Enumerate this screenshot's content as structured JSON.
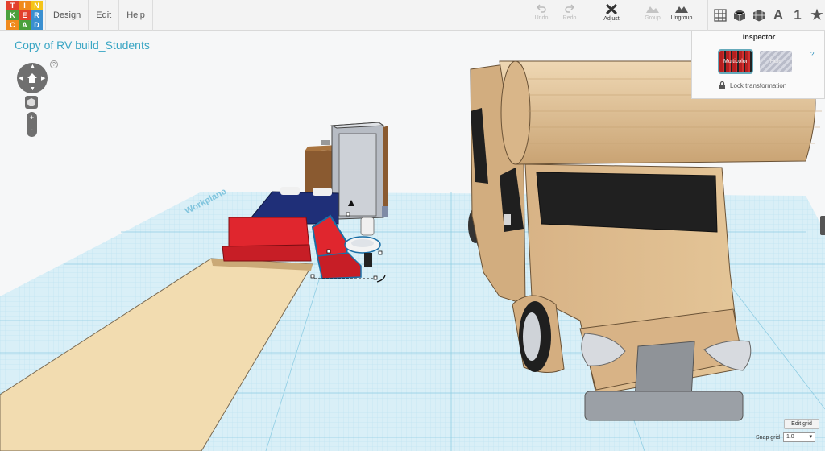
{
  "app": {
    "logo_letters": [
      "T",
      "I",
      "N",
      "K",
      "E",
      "R",
      "C",
      "A",
      "D"
    ],
    "logo_colors": [
      "#e2402c",
      "#f08a1c",
      "#f4c41a",
      "#4aa03c",
      "#e2402c",
      "#3a8fd0",
      "#f08a1c",
      "#4aa03c",
      "#3a8fd0"
    ]
  },
  "menu": {
    "items": [
      {
        "label": "Design"
      },
      {
        "label": "Edit"
      },
      {
        "label": "Help"
      }
    ]
  },
  "toolbar": {
    "undo_label": "Undo",
    "redo_label": "Redo",
    "adjust_label": "Adjust",
    "group_label": "Group",
    "ungroup_label": "Ungroup"
  },
  "view_icons": {
    "text_label": "A",
    "number_label": "1",
    "star_label": "★"
  },
  "project": {
    "title": "Copy of RV build_Students"
  },
  "help_mark": "?",
  "inspector": {
    "title": "Inspector",
    "solid_label": "Multicolor",
    "hole_label": "Hole",
    "help_mark": "?",
    "lock_label": "Lock transformation"
  },
  "grid": {
    "edit_label": "Edit grid",
    "snap_label": "Snap grid",
    "snap_value": "1.0"
  },
  "workplane": {
    "label": "Workplane"
  },
  "colors": {
    "accent": "#3aa6c4",
    "grid": "#9fd6ea",
    "rv_body": "#dcb88c",
    "seat_red": "#d8202a",
    "bed_blue": "#1f2f78"
  }
}
